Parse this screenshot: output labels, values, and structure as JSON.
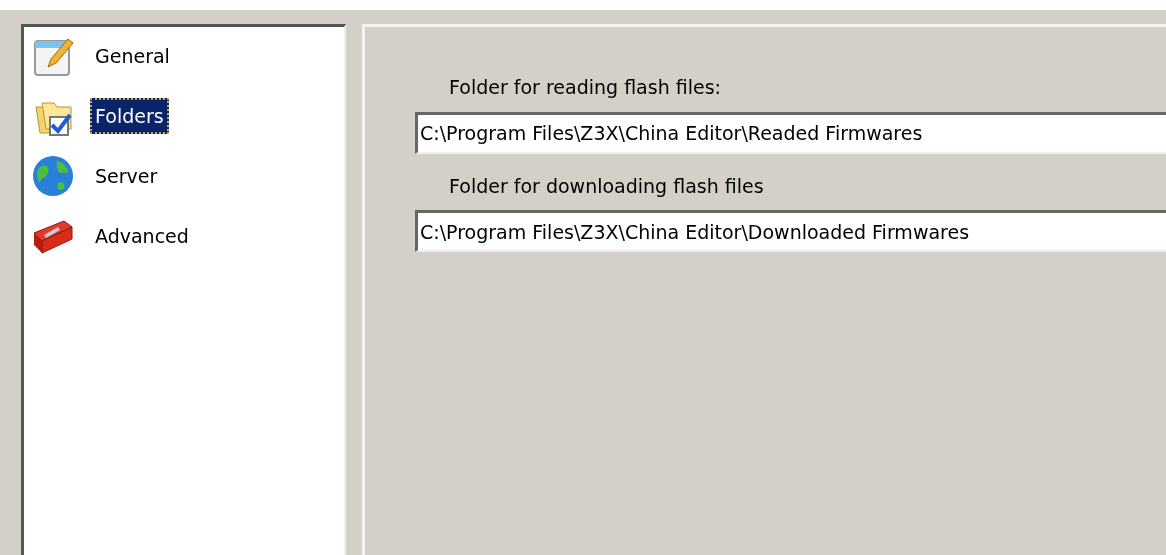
{
  "sidebar": {
    "items": [
      {
        "label": "General",
        "selected": false
      },
      {
        "label": "Folders",
        "selected": true
      },
      {
        "label": "Server",
        "selected": false
      },
      {
        "label": "Advanced",
        "selected": false
      }
    ]
  },
  "folders": [
    {
      "label": "Folder for reading flash files:",
      "value": "C:\\Program Files\\Z3X\\China Editor\\Readed Firmwares"
    },
    {
      "label": "Folder for downloading flash files",
      "value": "C:\\Program Files\\Z3X\\China Editor\\Downloaded Firmwares"
    }
  ]
}
